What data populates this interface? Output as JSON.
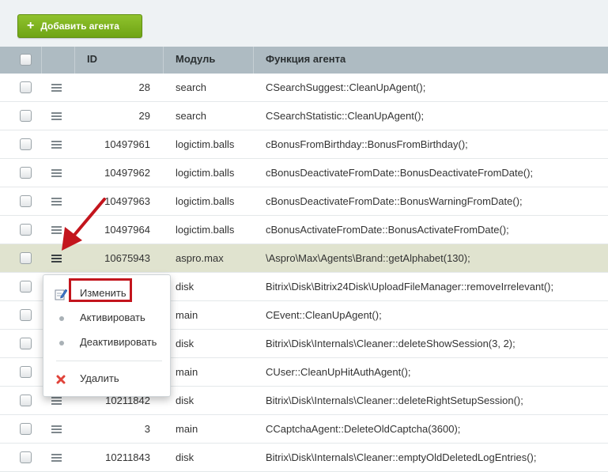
{
  "toolbar": {
    "add_label": "Добавить агента"
  },
  "columns": {
    "id": "ID",
    "module": "Модуль",
    "function": "Функция агента"
  },
  "rows": [
    {
      "id": "28",
      "module": "search",
      "func": "CSearchSuggest::CleanUpAgent();"
    },
    {
      "id": "29",
      "module": "search",
      "func": "CSearchStatistic::CleanUpAgent();"
    },
    {
      "id": "10497961",
      "module": "logictim.balls",
      "func": "cBonusFromBirthday::BonusFromBirthday();"
    },
    {
      "id": "10497962",
      "module": "logictim.balls",
      "func": "cBonusDeactivateFromDate::BonusDeactivateFromDate();"
    },
    {
      "id": "10497963",
      "module": "logictim.balls",
      "func": "cBonusDeactivateFromDate::BonusWarningFromDate();"
    },
    {
      "id": "10497964",
      "module": "logictim.balls",
      "func": "cBonusActivateFromDate::BonusActivateFromDate();"
    },
    {
      "id": "10675943",
      "module": "aspro.max",
      "func": "\\Aspro\\Max\\Agents\\Brand::getAlphabet(130);"
    },
    {
      "id": "",
      "module": "disk",
      "func": "Bitrix\\Disk\\Bitrix24Disk\\UploadFileManager::removeIrrelevant();"
    },
    {
      "id": "",
      "module": "main",
      "func": "CEvent::CleanUpAgent();"
    },
    {
      "id": "",
      "module": "disk",
      "func": "Bitrix\\Disk\\Internals\\Cleaner::deleteShowSession(3, 2);"
    },
    {
      "id": "",
      "module": "main",
      "func": "CUser::CleanUpHitAuthAgent();"
    },
    {
      "id": "10211842",
      "module": "disk",
      "func": "Bitrix\\Disk\\Internals\\Cleaner::deleteRightSetupSession();"
    },
    {
      "id": "3",
      "module": "main",
      "func": "CCaptchaAgent::DeleteOldCaptcha(3600);"
    },
    {
      "id": "10211843",
      "module": "disk",
      "func": "Bitrix\\Disk\\Internals\\Cleaner::emptyOldDeletedLogEntries();"
    }
  ],
  "context_menu": {
    "edit": "Изменить",
    "activate": "Активировать",
    "deactivate": "Деактивировать",
    "delete": "Удалить"
  },
  "colors": {
    "accent_green": "#7cb31d",
    "highlight_red": "#c3151d",
    "header_bg": "#aebbc2",
    "selected_row": "#e0e3cf"
  }
}
